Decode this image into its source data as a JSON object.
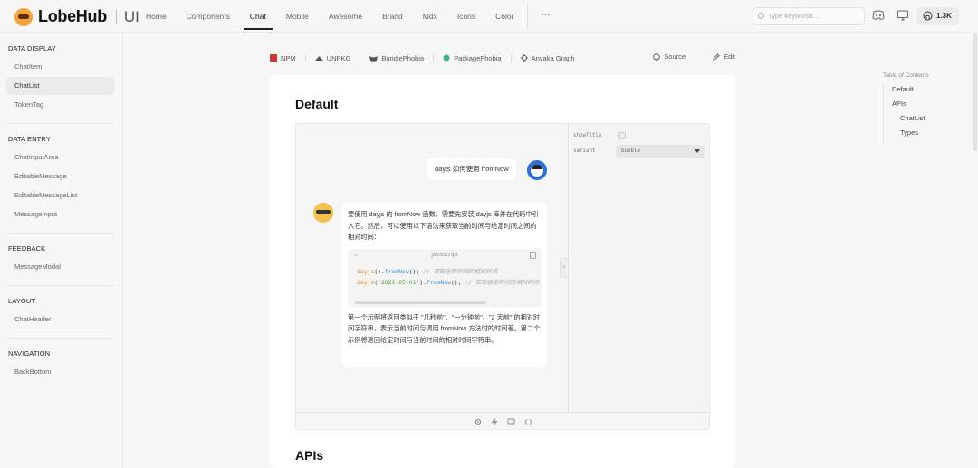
{
  "brand": {
    "name": "LobeHub",
    "suffix": "UI"
  },
  "nav": {
    "items": [
      "Home",
      "Components",
      "Chat",
      "Mobile",
      "Awesome",
      "Brand",
      "Mdx",
      "Icons",
      "Color"
    ],
    "active": "Chat",
    "more": "···"
  },
  "search": {
    "placeholder": "Type keywords..."
  },
  "github": {
    "stars": "1.3K"
  },
  "sidebar": {
    "groups": [
      {
        "title": "DATA DISPLAY",
        "items": [
          "ChatItem",
          "ChatList",
          "TokenTag"
        ]
      },
      {
        "title": "DATA ENTRY",
        "items": [
          "ChatInputArea",
          "EditableMessage",
          "EditableMessageList",
          "MessageInput"
        ]
      },
      {
        "title": "FEEDBACK",
        "items": [
          "MessageModal"
        ]
      },
      {
        "title": "LAYOUT",
        "items": [
          "ChatHeader"
        ]
      },
      {
        "title": "NAVIGATION",
        "items": [
          "BackBottom"
        ]
      }
    ],
    "active": "ChatList"
  },
  "doc_links": {
    "left": [
      "NPM",
      "UNPKG",
      "BundlePhobia",
      "PackagePhobia",
      "Anvaka Graph"
    ],
    "right": [
      "Source",
      "Edit"
    ]
  },
  "content": {
    "heading": "Default",
    "apis_heading": "APIs"
  },
  "demo": {
    "user_message": "dayjs 如何使用 fromNow",
    "ai_intro": "要使用 dayjs 的 fromNow 函数，需要先安装 dayjs 库并在代码中引入它。然后，可以使用以下语法来获取当前时间与给定时间之间的相对时间：",
    "code_lang": "javascript",
    "code_lines": [
      {
        "fn": "dayjs",
        "arg": "",
        "method": "fromNow",
        "comment": "// 获取当前时间的相对时间"
      },
      {
        "fn": "dayjs",
        "arg": "'2021-05-01'",
        "method": "fromNow",
        "comment": "// 获取给定时间的相对时间"
      }
    ],
    "ai_outro": "第一个示例将返回类似于 \"几秒前\"、\"一分钟前\"、\"2 天前\" 的相对时间字符串，表示当前时间与调用 fromNow 方法时的时间差。第二个示例将返回给定时间与当前时间的相对时间字符串。",
    "controls": {
      "showTitle": {
        "label": "showTitle",
        "value": false
      },
      "variant": {
        "label": "variant",
        "value": "bubble"
      }
    }
  },
  "toc": {
    "title": "Table of Contents",
    "items": [
      {
        "label": "Default",
        "level": 1
      },
      {
        "label": "APIs",
        "level": 1
      },
      {
        "label": "ChatList",
        "level": 2
      },
      {
        "label": "Types",
        "level": 2
      }
    ]
  }
}
